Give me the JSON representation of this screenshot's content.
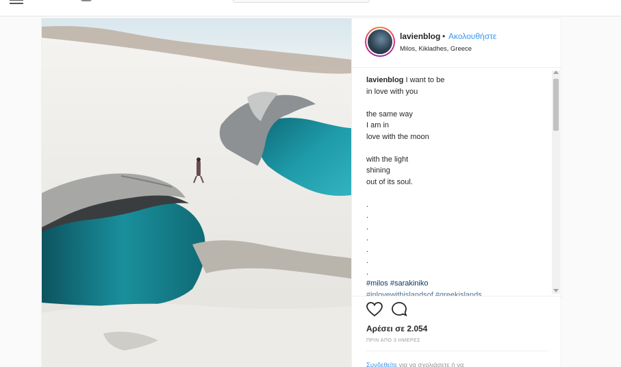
{
  "post": {
    "username": "lavienblog",
    "separator": "•",
    "follow_label": "Ακολουθήστε",
    "location": "Milos, Kikladhes, Greece",
    "caption": {
      "author": "lavienblog",
      "first_line": "I want to be",
      "lines": [
        "in love with you",
        "",
        "the same way",
        "I am in",
        "love with the moon",
        "",
        "with the light",
        "shining",
        "out of its soul.",
        "",
        ".",
        ".",
        ".",
        ".",
        ".",
        ".",
        "."
      ],
      "hashtags": "#milos #sarakiniko",
      "hashtags_cut": "#inlovewithislandsof #greekislands"
    },
    "likes": "Αρέσει σε 2.054",
    "time": "ΠΡΙΝ ΑΠΟ 3 ΗΜΕΡΕΣ",
    "login_prompt": {
      "link": "Συνδεθείτε",
      "text": "για να σχολιάσετε ή να"
    }
  },
  "icons": {
    "like": "heart-outline-icon",
    "comment": "speech-bubble-icon",
    "menu": "hamburger-menu-icon"
  },
  "colors": {
    "link_blue": "#3897f0",
    "hashtag_blue": "#003569",
    "water": "#1f9aa6",
    "rock": "#f2f1ed"
  }
}
